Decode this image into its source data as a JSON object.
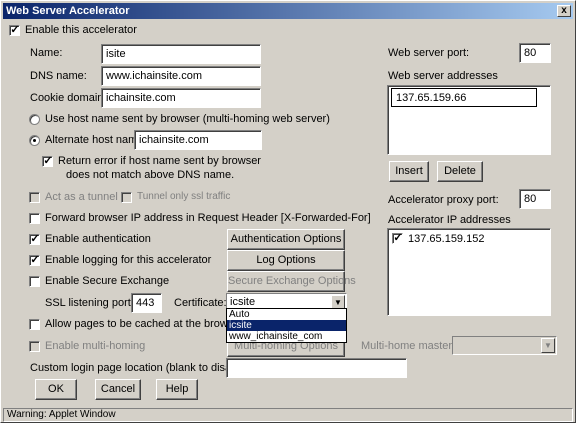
{
  "window": {
    "title": "Web Server Accelerator",
    "close_label": "x"
  },
  "general": {
    "enable_accelerator_label": "Enable this accelerator",
    "name_label": "Name:",
    "name_value": "isite",
    "dns_label": "DNS name:",
    "dns_value": "www.ichainsite.com",
    "cookie_label": "Cookie domain:",
    "cookie_value": "ichainsite.com",
    "use_host_label": "Use host name sent by browser (multi-homing web server)",
    "alt_host_label": "Alternate host name",
    "alt_host_value": "ichainsite.com",
    "return_error_line1": "Return error if host name sent by browser",
    "return_error_line2": "does not match above DNS name.",
    "tunnel_label": "Act as a tunnel",
    "tunnel_ssl_label": "Tunnel only ssl traffic",
    "forward_ip_label": "Forward browser IP address in Request Header [X-Forwarded-For]",
    "auth_label": "Enable authentication",
    "auth_button": "Authentication Options",
    "logging_label": "Enable logging for this accelerator",
    "log_button": "Log Options",
    "secure_label": "Enable Secure Exchange",
    "secure_button": "Secure Exchange Options",
    "ssl_port_label": "SSL listening port:",
    "ssl_port_value": "443",
    "cert_label": "Certificate:",
    "cert_value": "icsite",
    "cert_options": [
      "Auto",
      "icsite",
      "www_ichainsite_com"
    ],
    "cache_label": "Allow pages to be cached at the browser",
    "multihome_label": "Enable multi-homing",
    "multihome_button": "Multi-homing Options",
    "multihome_master_label": "Multi-home master:",
    "custom_login_label": "Custom login page location (blank to disable):",
    "custom_login_value": ""
  },
  "right": {
    "web_port_label": "Web server port:",
    "web_port_value": "80",
    "web_addresses_label": "Web server addresses",
    "web_addresses": [
      "137.65.159.66"
    ],
    "insert_button": "Insert",
    "delete_button": "Delete",
    "proxy_port_label": "Accelerator proxy port:",
    "proxy_port_value": "80",
    "accel_ip_label": "Accelerator IP addresses",
    "accel_ips": [
      "137.65.159.152"
    ]
  },
  "footer": {
    "ok": "OK",
    "cancel": "Cancel",
    "help": "Help"
  },
  "status": {
    "text": "Warning: Applet Window"
  }
}
